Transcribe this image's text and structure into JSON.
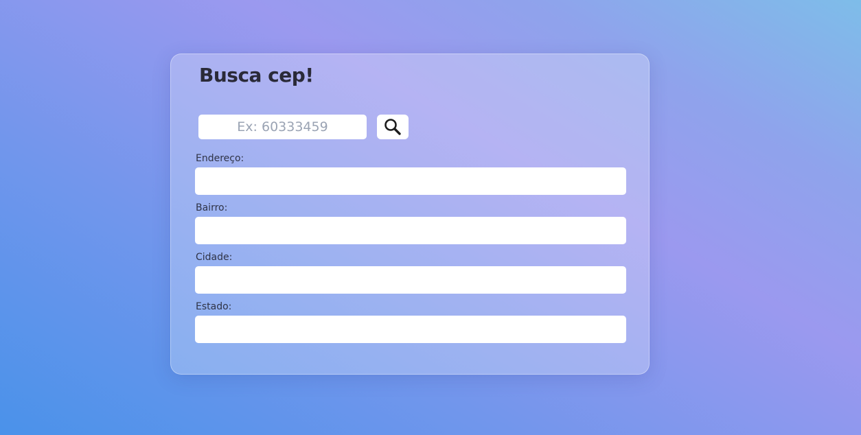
{
  "card": {
    "title": "Busca cep!"
  },
  "search": {
    "placeholder": "Ex: 60333459",
    "value": "",
    "button_icon": "search-icon"
  },
  "fields": [
    {
      "label": "Endereço:",
      "value": ""
    },
    {
      "label": "Bairro:",
      "value": ""
    },
    {
      "label": "Cidade:",
      "value": ""
    },
    {
      "label": "Estado:",
      "value": ""
    }
  ],
  "colors": {
    "card_background": "#ffffff42",
    "input_background": "#ffffff",
    "title_text": "#2a2a38",
    "label_text": "#2f3346",
    "placeholder_text": "#9aa3b3"
  }
}
